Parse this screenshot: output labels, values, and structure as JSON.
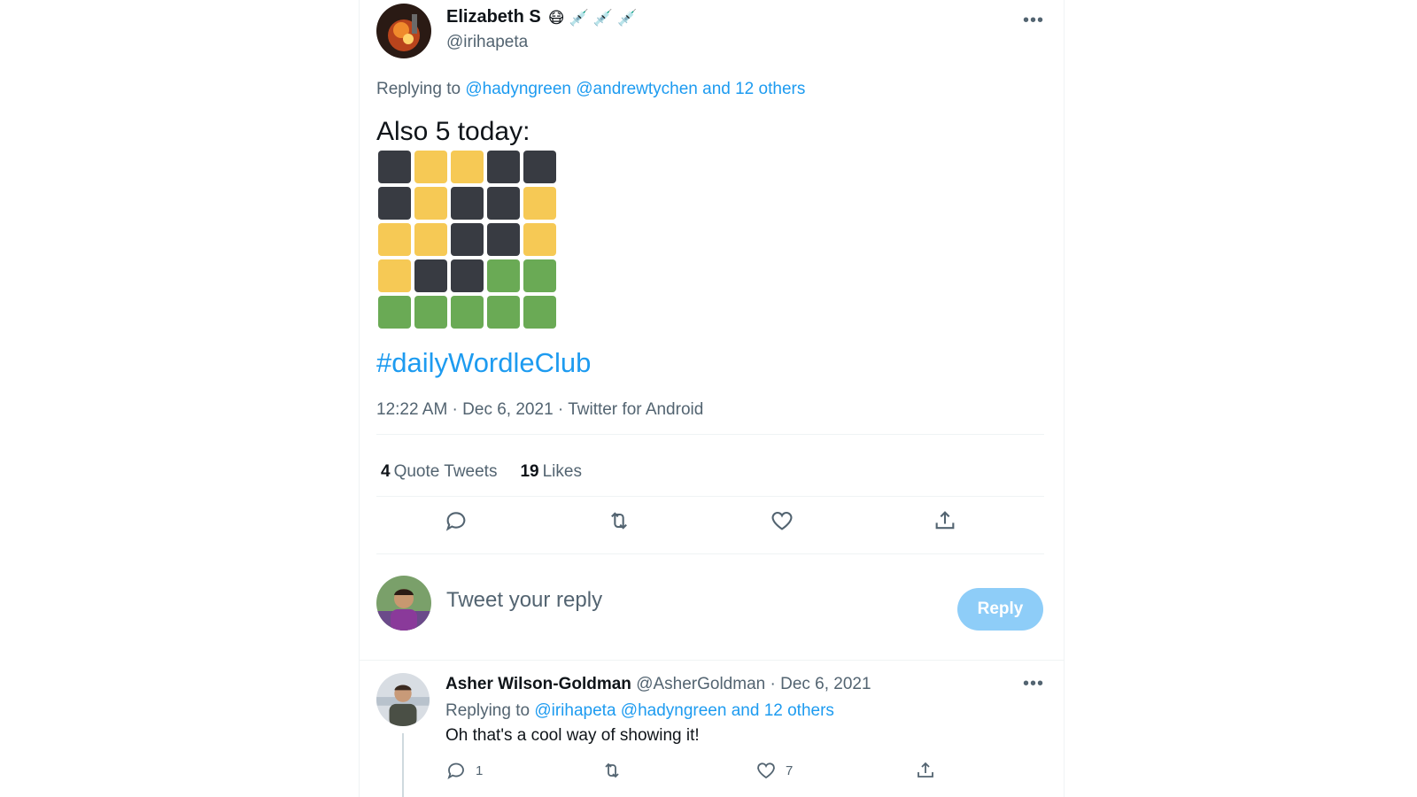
{
  "tweet": {
    "author_name": "Elizabeth S",
    "author_emoji": "😷 💉 💉 💉",
    "author_handle": "@irihapeta",
    "more_label": "•••",
    "replying_prefix": "Replying to",
    "replying_handles": "@hadyngreen @andrewtychen and 12 others",
    "text": "Also 5 today:",
    "hashtag": "#dailyWordleClub",
    "time": "12:22 AM",
    "date": "Dec 6, 2021",
    "source": "Twitter for Android",
    "sep": " · "
  },
  "wordle_grid": [
    [
      "dark",
      "yellow",
      "yellow",
      "dark",
      "dark"
    ],
    [
      "dark",
      "yellow",
      "dark",
      "dark",
      "yellow"
    ],
    [
      "yellow",
      "yellow",
      "dark",
      "dark",
      "yellow"
    ],
    [
      "yellow",
      "dark",
      "dark",
      "green",
      "green"
    ],
    [
      "green",
      "green",
      "green",
      "green",
      "green"
    ]
  ],
  "colors": {
    "dark": "#383b42",
    "yellow": "#f6c955",
    "green": "#6aaa55",
    "accent": "#1d9bf0"
  },
  "stats": {
    "quote_count": "4",
    "quote_label": "Quote Tweets",
    "likes_count": "19",
    "likes_label": "Likes"
  },
  "actions": [
    "comment-icon",
    "retweet-icon",
    "heart-icon",
    "share-icon"
  ],
  "compose": {
    "placeholder": "Tweet your reply",
    "button_label": "Reply"
  },
  "reply": {
    "author_name": "Asher Wilson-Goldman",
    "author_handle": "@AsherGoldman",
    "date": "Dec 6, 2021",
    "replying_prefix": "Replying to",
    "replying_handles": "@irihapeta @hadyngreen and 12 others",
    "text": "Oh that's a cool way of showing it!",
    "reply_count": "1",
    "like_count": "7",
    "more_label": "•••"
  }
}
